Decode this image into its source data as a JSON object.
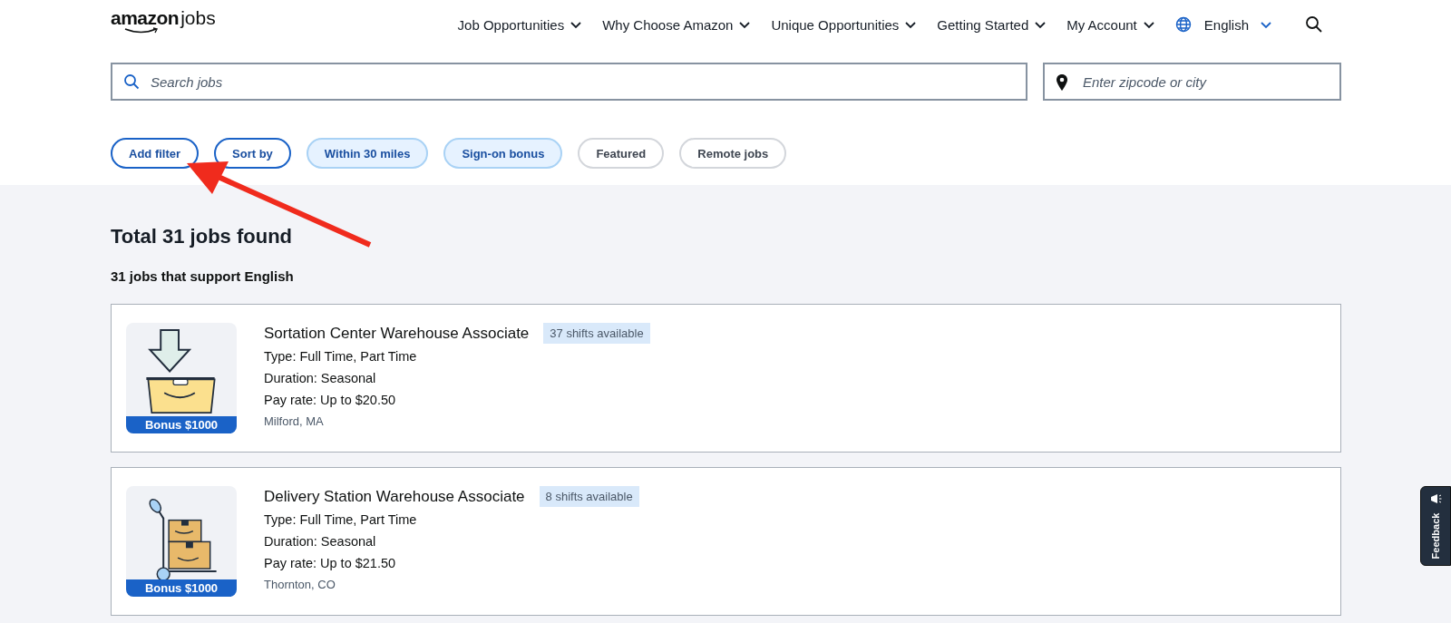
{
  "header": {
    "logo": {
      "brand": "amazon",
      "product": "jobs"
    },
    "nav": [
      {
        "label": "Job Opportunities"
      },
      {
        "label": "Why Choose Amazon"
      },
      {
        "label": "Unique Opportunities"
      },
      {
        "label": "Getting Started"
      },
      {
        "label": "My Account"
      }
    ],
    "language": "English"
  },
  "search": {
    "placeholder": "Search jobs"
  },
  "location": {
    "placeholder": "Enter zipcode or city"
  },
  "filters": [
    {
      "label": "Add filter",
      "kind": "action"
    },
    {
      "label": "Sort by",
      "kind": "action"
    },
    {
      "label": "Within 30 miles",
      "kind": "toggle",
      "selected": true
    },
    {
      "label": "Sign-on bonus",
      "kind": "toggle",
      "selected": true
    },
    {
      "label": "Featured",
      "kind": "toggle",
      "selected": false
    },
    {
      "label": "Remote jobs",
      "kind": "toggle",
      "selected": false
    }
  ],
  "results": {
    "title": "Total 31 jobs found",
    "subtitle": "31 jobs that support English"
  },
  "jobs": [
    {
      "title": "Sortation Center Warehouse Associate",
      "shifts": "37 shifts available",
      "type": "Type: Full Time, Part Time",
      "duration": "Duration: Seasonal",
      "pay": "Pay rate: Up to $20.50",
      "location": "Milford, MA",
      "bonus": "Bonus $1000",
      "kind": "sortation"
    },
    {
      "title": "Delivery Station Warehouse Associate",
      "shifts": "8 shifts available",
      "type": "Type: Full Time, Part Time",
      "duration": "Duration: Seasonal",
      "pay": "Pay rate: Up to $21.50",
      "location": "Thornton, CO",
      "bonus": "Bonus $1000",
      "kind": "delivery"
    }
  ],
  "feedback": "Feedback"
}
